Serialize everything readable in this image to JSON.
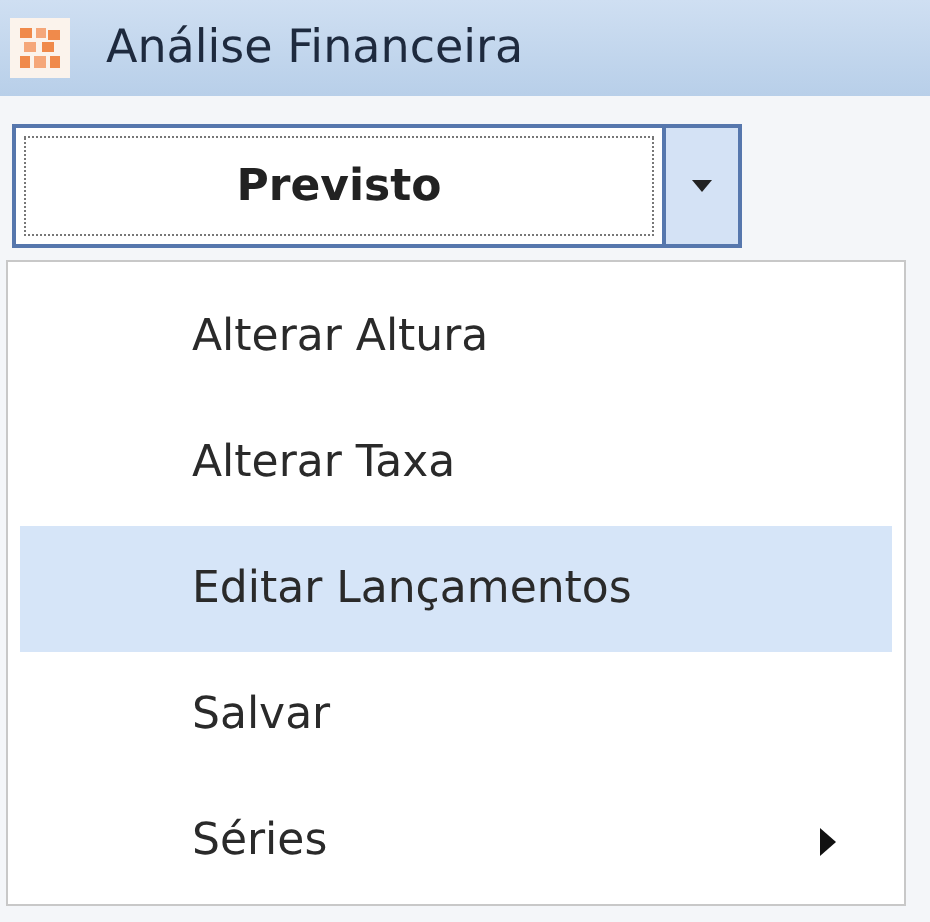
{
  "window": {
    "title": "Análise Financeira"
  },
  "combo": {
    "value": "Previsto"
  },
  "menu": [
    {
      "label": "Alterar Altura",
      "selected": false,
      "submenu": false
    },
    {
      "label": "Alterar Taxa",
      "selected": false,
      "submenu": false
    },
    {
      "label": "Editar Lançamentos",
      "selected": true,
      "submenu": false
    },
    {
      "label": "Salvar",
      "selected": false,
      "submenu": false
    },
    {
      "label": "Séries",
      "selected": false,
      "submenu": true
    }
  ]
}
